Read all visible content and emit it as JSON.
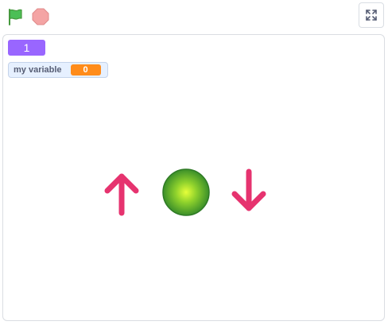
{
  "toolbar": {
    "green_flag_icon": "green-flag-icon",
    "stop_icon": "stop-icon",
    "fullscreen_icon": "fullscreen-icon"
  },
  "stage": {
    "list_monitor": {
      "value": "1",
      "color": "#9966ff"
    },
    "variable_monitor": {
      "label": "my variable",
      "value": "0",
      "value_color": "#ff8c1a"
    },
    "sprites": [
      {
        "name": "arrow-up",
        "color": "#e6336f"
      },
      {
        "name": "ball",
        "color": "#7cc62b"
      },
      {
        "name": "arrow-down",
        "color": "#e6336f"
      }
    ]
  }
}
